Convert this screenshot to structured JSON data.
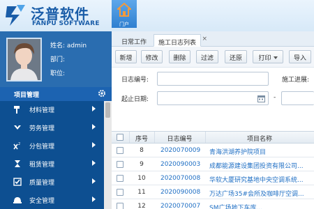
{
  "brand": {
    "name": "泛普软件",
    "sub": "FANPU SOFTWARE"
  },
  "header": {
    "home_label": "门户"
  },
  "user": {
    "name_label": "姓名: admin",
    "dept_label": "部门:",
    "title_label": "职位:"
  },
  "module": {
    "title": "项目管理"
  },
  "menu": [
    {
      "label": "材料管理",
      "icon": "hammer-icon"
    },
    {
      "label": "劳务管理",
      "icon": "people-icon"
    },
    {
      "label": "分包管理",
      "icon": "x-squared-icon"
    },
    {
      "label": "租赁管理",
      "icon": "hourglass-icon"
    },
    {
      "label": "质量管理",
      "icon": "checkbox-icon"
    },
    {
      "label": "安全管理",
      "icon": "helmet-icon"
    }
  ],
  "tabs": [
    {
      "label": "日常工作",
      "active": false
    },
    {
      "label": "施工日志列表",
      "active": true
    }
  ],
  "toolbar": {
    "new": "新增",
    "edit": "修改",
    "delete": "删除",
    "filter": "过滤",
    "restore": "还原",
    "print": "打印",
    "import": "导入"
  },
  "filters": {
    "log_no_label": "日志编号:",
    "progress_label": "施工进展:",
    "start_date_label": "起止日期:",
    "date_sep": "-"
  },
  "table": {
    "headers": {
      "index": "序号",
      "log_no": "日志编号",
      "project": "项目名称"
    },
    "rows": [
      {
        "index": "8",
        "log_no": "2020070009",
        "project": "青海洪湖养护院项目"
      },
      {
        "index": "9",
        "log_no": "2020090003",
        "project": "成都能源建设集团投资有限公司..."
      },
      {
        "index": "10",
        "log_no": "2020070008",
        "project": "华软大厦研究基地中央空调系统..."
      },
      {
        "index": "11",
        "log_no": "2020090008",
        "project": "万达广场35#会所及咖啡厅空调..."
      },
      {
        "index": "12",
        "log_no": "2020070007",
        "project": "SM广场地下车库..."
      }
    ]
  },
  "colors": {
    "accent": "#1f6fc4",
    "sidebar": "#0d4f91",
    "brand": "#1a5da8"
  }
}
